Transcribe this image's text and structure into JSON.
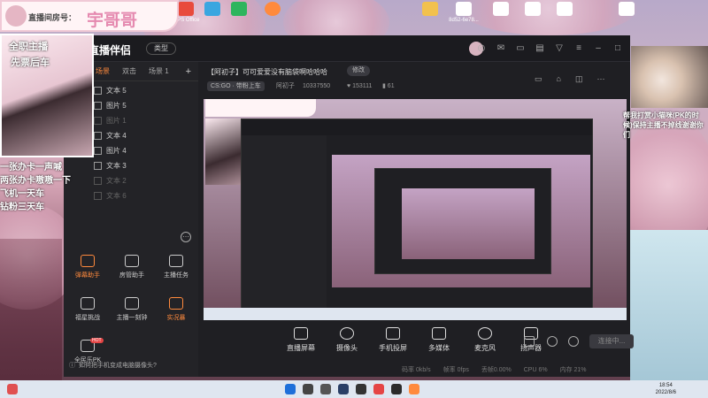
{
  "desktop": {
    "icons": [
      {
        "label": "",
        "color": "#e84a3c",
        "icon": "w-icon"
      },
      {
        "label": "WPS Office",
        "color": "#e84a3c",
        "icon": "wps-icon"
      },
      {
        "label": "",
        "color": "#3aa6e0",
        "icon": "app-icon"
      },
      {
        "label": "",
        "color": "#2db55d",
        "icon": "wechat-icon"
      },
      {
        "label": "",
        "color": "#ff8a3d",
        "icon": "app-icon"
      },
      {
        "label": "",
        "color": "#f2c14e",
        "icon": "folder-icon"
      },
      {
        "label": "8d52-6e78...",
        "color": "#ffffff",
        "icon": "file-icon"
      },
      {
        "label": "",
        "color": "#ffffff",
        "icon": "file-icon"
      },
      {
        "label": "",
        "color": "#ffffff",
        "icon": "file-icon"
      },
      {
        "label": "",
        "color": "#ffffff",
        "icon": "file-icon"
      },
      {
        "label": "",
        "color": "#ffffff",
        "icon": "file-icon"
      }
    ]
  },
  "overlay": {
    "tag": "直播间房号：",
    "name": "宇哥哥",
    "photo_top": "全职主播",
    "photo_sub": "先票后车",
    "side_lines": [
      "一张办卡一声喊",
      "两张办卡嗷嗷一下",
      "飞机一天车",
      "钻粉三天车"
    ]
  },
  "app": {
    "logo": "直播伴侣",
    "type_label": "类型",
    "tabs": [
      "场景",
      "双击",
      "场景 1"
    ],
    "add": "+",
    "sources": [
      {
        "label": "文本 5",
        "dim": false
      },
      {
        "label": "图片 5",
        "dim": false
      },
      {
        "label": "图片 1",
        "dim": true
      },
      {
        "label": "文本 4",
        "dim": false
      },
      {
        "label": "图片 4",
        "dim": false
      },
      {
        "label": "文本 3",
        "dim": false
      },
      {
        "label": "文本 2",
        "dim": true
      },
      {
        "label": "文本 6",
        "dim": true
      }
    ],
    "tools": [
      {
        "label": "弹幕助手",
        "orange": true
      },
      {
        "label": "房管助手",
        "orange": false
      },
      {
        "label": "主播任务",
        "orange": false
      },
      {
        "label": "福星挑战",
        "orange": false
      },
      {
        "label": "主播一刻钟",
        "orange": false
      },
      {
        "label": "实况暴",
        "orange": true
      },
      {
        "label": "全民乐PK",
        "orange": false
      }
    ],
    "hot": "HOT",
    "hint": "如何把手机变成电脑摄像头?",
    "room_title": "【阿初子】可可爱爱没有脑袋啊哈哈哈",
    "edit": "修改",
    "category": "CS:GO · 带粉上车",
    "streamer": "阿初子",
    "room_id": "10337550",
    "fans": "153111",
    "level": "61",
    "bottom_tools": [
      "直播屏幕",
      "摄像头",
      "手机投屏",
      "多媒体",
      "麦克风",
      "扬声器"
    ],
    "start": "连接中...",
    "status": [
      "码率 0kb/s",
      "帧率 0fps",
      "丢帧0.00%",
      "CPU 6%",
      "内存 21%"
    ]
  },
  "right": {
    "cat_text": "帮我打赏小猫咪(PK的时候)保持主播不掉线谢谢你们"
  },
  "taskbar": {
    "time": "18:54",
    "date": "2022/8/6"
  }
}
